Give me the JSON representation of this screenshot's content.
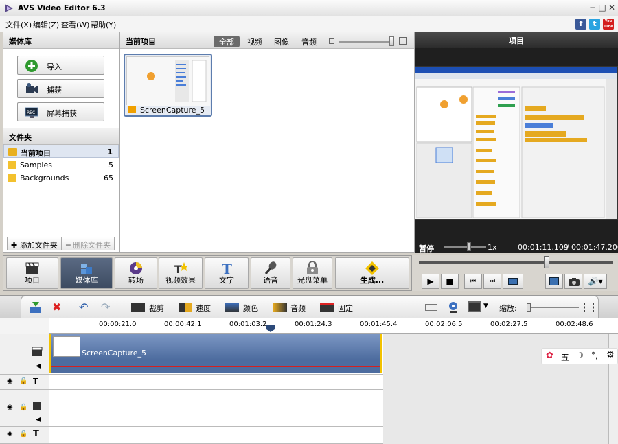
{
  "window": {
    "title": "AVS Video Editor 6.3"
  },
  "menu": [
    {
      "label": "文件(X)"
    },
    {
      "label": "编辑(Z)"
    },
    {
      "label": "查看(W)"
    },
    {
      "label": "帮助(Y)"
    }
  ],
  "social": {
    "facebook": "f",
    "twitter": "t",
    "youtube": "You Tube"
  },
  "left_panel": {
    "title": "媒体库",
    "import_label": "导入",
    "capture_label": "捕获",
    "screen_capture_label": "屏幕捕获",
    "folders_title": "文件夹",
    "folders": [
      {
        "name": "当前项目",
        "count": "1"
      },
      {
        "name": "Samples",
        "count": "5"
      },
      {
        "name": "Backgrounds",
        "count": "65"
      }
    ],
    "add_folder_label": "✚ 添加文件夹",
    "delete_folder_label": "━ 删除文件夹"
  },
  "media_panel": {
    "title": "当前项目",
    "tabs": [
      "全部",
      "视频",
      "图像",
      "音频"
    ],
    "active_tab": "全部",
    "items": [
      {
        "name": "ScreenCapture_5"
      }
    ]
  },
  "preview": {
    "title": "项目",
    "status": "暂停",
    "speed": "1x",
    "current_time": "00:01:11.109",
    "total_time": "00:01:47.200",
    "time_separator": "/"
  },
  "toolbar": {
    "buttons": [
      {
        "label": "项目"
      },
      {
        "label": "媒体库"
      },
      {
        "label": "转场"
      },
      {
        "label": "视频效果"
      },
      {
        "label": "文字"
      },
      {
        "label": "语音"
      },
      {
        "label": "光盘菜单"
      },
      {
        "label": "生成..."
      }
    ],
    "active": "媒体库"
  },
  "timeline_toolbar": {
    "trim": "裁剪",
    "speed": "速度",
    "color": "颜色",
    "audio": "音频",
    "freeze": "固定",
    "zoom_label": "缩放:"
  },
  "timeline": {
    "ticks": [
      "00:00:21.0",
      "00:00:42.1",
      "00:01:03.2",
      "00:01:24.3",
      "00:01:45.4",
      "00:02:06.5",
      "00:02:27.5",
      "00:02:48.6"
    ],
    "clip_name": "ScreenCapture_5"
  },
  "ime_bar": {
    "text": "五"
  },
  "colors": {
    "accent": "#5d7dae",
    "playhead": "#2c4a7a",
    "audio_line": "#d42020",
    "clip_edge": "#f2c200"
  }
}
